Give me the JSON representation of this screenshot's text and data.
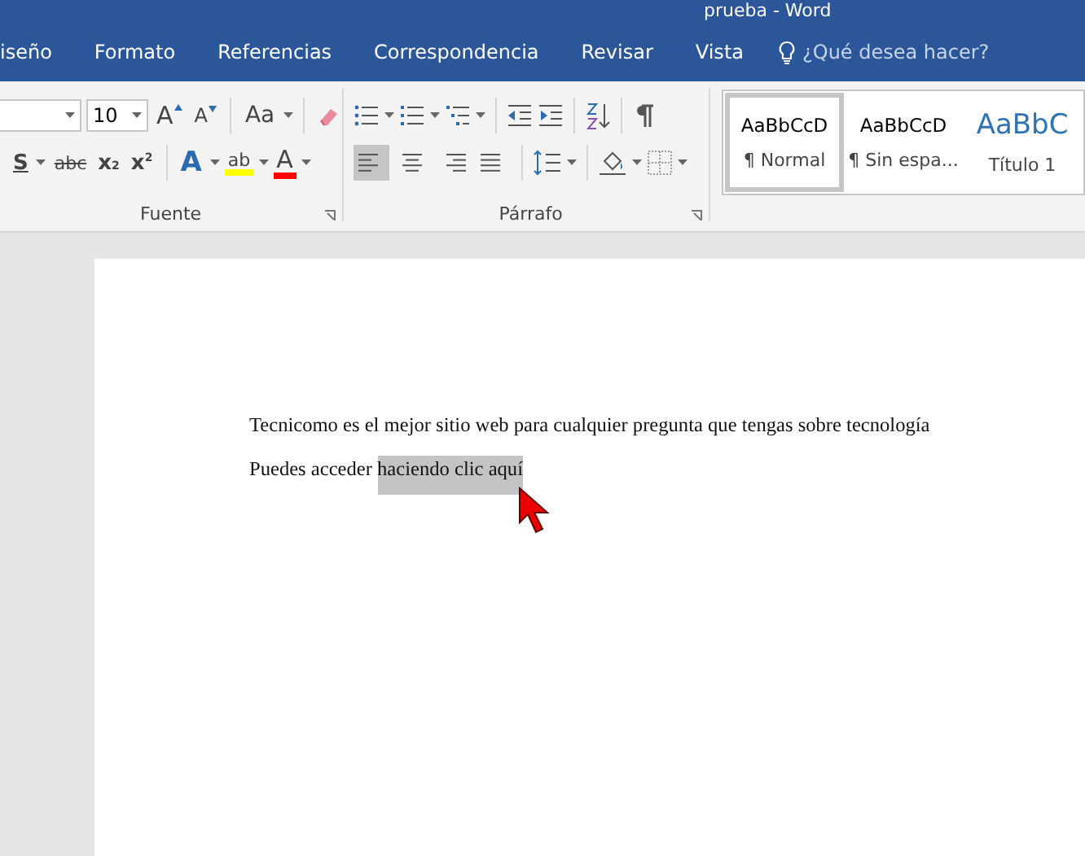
{
  "window": {
    "title": "prueba - Word"
  },
  "tabs": [
    {
      "label": "iseño",
      "selected": false
    },
    {
      "label": "Formato",
      "selected": false
    },
    {
      "label": "Referencias",
      "selected": false
    },
    {
      "label": "Correspondencia",
      "selected": false
    },
    {
      "label": "Revisar",
      "selected": false
    },
    {
      "label": "Vista",
      "selected": false
    }
  ],
  "tell_me": {
    "placeholder": "¿Qué desea hacer?"
  },
  "font_group": {
    "label": "Fuente",
    "font_size": "10",
    "grow": "A",
    "shrink": "A",
    "case": "Aa",
    "underline": "S",
    "strike": "abc",
    "subscript": "x",
    "subscript_mark": "2",
    "superscript": "x",
    "superscript_mark": "2",
    "effects": "A",
    "highlight": "ab",
    "font_color": "A"
  },
  "paragraph_group": {
    "label": "Párrafo",
    "alignments": [
      {
        "kind": "left",
        "selected": true
      },
      {
        "kind": "center",
        "selected": false
      },
      {
        "kind": "right",
        "selected": false
      },
      {
        "kind": "justify",
        "selected": false
      }
    ]
  },
  "styles": [
    {
      "preview": "AaBbCcD",
      "name": "¶ Normal",
      "kind": "body",
      "selected": true
    },
    {
      "preview": "AaBbCcD",
      "name": "¶ Sin espa...",
      "kind": "body",
      "selected": false
    },
    {
      "preview": "AaBbC",
      "name": "Título 1",
      "kind": "heading",
      "selected": false
    }
  ],
  "document": {
    "paragraphs": [
      [
        {
          "text": "Tecnicomo es el mejor sitio web para cualquier pregunta que tengas sobre tecnología",
          "selected": false
        }
      ],
      [
        {
          "text": "Puedes acceder ",
          "selected": false
        },
        {
          "text": "haciendo clic aquí",
          "selected": true
        }
      ]
    ]
  }
}
